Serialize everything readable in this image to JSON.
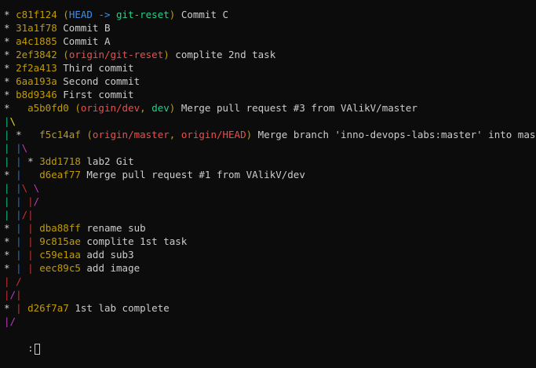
{
  "colors": {
    "default": "#cccccc",
    "hash": "#c19c00",
    "ref_paren": "#c19c00",
    "head": "#3b8eea",
    "local_branch": "#23d18b",
    "remote_branch": "#f14c4c",
    "graph_red": "#cd3131",
    "graph_green": "#0dbc79",
    "graph_yellow": "#e5e510",
    "graph_blue": "#2472c8",
    "graph_magenta": "#bc3fbc"
  },
  "lines": [
    {
      "segs": [
        [
          "* ",
          "default"
        ],
        [
          "c81f124",
          "hash"
        ],
        [
          " (",
          "ref_paren"
        ],
        [
          "HEAD -> ",
          "head"
        ],
        [
          "git-reset",
          "local_branch"
        ],
        [
          ")",
          "ref_paren"
        ],
        [
          " Commit C",
          "default"
        ]
      ]
    },
    {
      "segs": [
        [
          "* ",
          "default"
        ],
        [
          "31a1f78",
          "hash"
        ],
        [
          " Commit B",
          "default"
        ]
      ]
    },
    {
      "segs": [
        [
          "* ",
          "default"
        ],
        [
          "a4c1885",
          "hash"
        ],
        [
          " Commit A",
          "default"
        ]
      ]
    },
    {
      "segs": [
        [
          "* ",
          "default"
        ],
        [
          "2ef3842",
          "hash"
        ],
        [
          " (",
          "ref_paren"
        ],
        [
          "origin/git-reset",
          "remote_branch"
        ],
        [
          ")",
          "ref_paren"
        ],
        [
          " complite 2nd task",
          "default"
        ]
      ]
    },
    {
      "segs": [
        [
          "* ",
          "default"
        ],
        [
          "2f2a413",
          "hash"
        ],
        [
          " Third commit",
          "default"
        ]
      ]
    },
    {
      "segs": [
        [
          "* ",
          "default"
        ],
        [
          "6aa193a",
          "hash"
        ],
        [
          " Second commit",
          "default"
        ]
      ]
    },
    {
      "segs": [
        [
          "* ",
          "default"
        ],
        [
          "b8d9346",
          "hash"
        ],
        [
          " First commit",
          "default"
        ]
      ]
    },
    {
      "segs": [
        [
          "*   ",
          "default"
        ],
        [
          "a5b0fd0",
          "hash"
        ],
        [
          " (",
          "ref_paren"
        ],
        [
          "origin/dev",
          "remote_branch"
        ],
        [
          ", ",
          "ref_paren"
        ],
        [
          "dev",
          "local_branch"
        ],
        [
          ")",
          "ref_paren"
        ],
        [
          " Merge pull request #3 from VAlikV/master",
          "default"
        ]
      ]
    },
    {
      "segs": [
        [
          "|",
          "graph_green"
        ],
        [
          "\\",
          "graph_yellow"
        ]
      ]
    },
    {
      "segs": [
        [
          "| ",
          "graph_green"
        ],
        [
          "*   ",
          "default"
        ],
        [
          "f5c14af",
          "hash"
        ],
        [
          " (",
          "ref_paren"
        ],
        [
          "origin/master",
          "remote_branch"
        ],
        [
          ", ",
          "ref_paren"
        ],
        [
          "origin/HEAD",
          "remote_branch"
        ],
        [
          ")",
          "ref_paren"
        ],
        [
          " Merge branch 'inno-devops-labs:master' into master",
          "default"
        ]
      ]
    },
    {
      "segs": [
        [
          "| ",
          "graph_green"
        ],
        [
          "|",
          "graph_blue"
        ],
        [
          "\\",
          "graph_magenta"
        ]
      ]
    },
    {
      "segs": [
        [
          "| ",
          "graph_green"
        ],
        [
          "| ",
          "graph_blue"
        ],
        [
          "* ",
          "default"
        ],
        [
          "3dd1718",
          "hash"
        ],
        [
          " lab2 Git",
          "default"
        ]
      ]
    },
    {
      "segs": [
        [
          "* ",
          "default"
        ],
        [
          "| ",
          "graph_blue"
        ],
        [
          "  ",
          "default"
        ],
        [
          "d6eaf77",
          "hash"
        ],
        [
          " Merge pull request #1 from VAlikV/dev",
          "default"
        ]
      ]
    },
    {
      "segs": [
        [
          "| ",
          "graph_green"
        ],
        [
          "|",
          "graph_blue"
        ],
        [
          "\\ ",
          "graph_red"
        ],
        [
          "\\",
          "graph_magenta"
        ]
      ]
    },
    {
      "segs": [
        [
          "| ",
          "graph_green"
        ],
        [
          "| ",
          "graph_blue"
        ],
        [
          "|",
          "graph_red"
        ],
        [
          "/",
          "graph_magenta"
        ]
      ]
    },
    {
      "segs": [
        [
          "| ",
          "graph_green"
        ],
        [
          "|",
          "graph_blue"
        ],
        [
          "/",
          "graph_red"
        ],
        [
          "|",
          "graph_red"
        ]
      ]
    },
    {
      "segs": [
        [
          "* ",
          "default"
        ],
        [
          "| ",
          "graph_blue"
        ],
        [
          "| ",
          "graph_red"
        ],
        [
          "dba88ff",
          "hash"
        ],
        [
          " rename sub",
          "default"
        ]
      ]
    },
    {
      "segs": [
        [
          "* ",
          "default"
        ],
        [
          "| ",
          "graph_blue"
        ],
        [
          "| ",
          "graph_red"
        ],
        [
          "9c815ae",
          "hash"
        ],
        [
          " complite 1st task",
          "default"
        ]
      ]
    },
    {
      "segs": [
        [
          "* ",
          "default"
        ],
        [
          "| ",
          "graph_blue"
        ],
        [
          "| ",
          "graph_red"
        ],
        [
          "c59e1aa",
          "hash"
        ],
        [
          " add sub3",
          "default"
        ]
      ]
    },
    {
      "segs": [
        [
          "* ",
          "default"
        ],
        [
          "| ",
          "graph_blue"
        ],
        [
          "| ",
          "graph_red"
        ],
        [
          "eec89c5",
          "hash"
        ],
        [
          " add image",
          "default"
        ]
      ]
    },
    {
      "segs": [
        [
          "| ",
          "graph_red"
        ],
        [
          "/",
          "graph_red"
        ]
      ]
    },
    {
      "segs": [
        [
          "|",
          "graph_red"
        ],
        [
          "/",
          "graph_magenta"
        ],
        [
          "|",
          "graph_red"
        ]
      ]
    },
    {
      "segs": [
        [
          "* ",
          "default"
        ],
        [
          "| ",
          "graph_red"
        ],
        [
          "d26f7a7",
          "hash"
        ],
        [
          " 1st lab complete",
          "default"
        ]
      ]
    },
    {
      "segs": [
        [
          "|",
          "graph_magenta"
        ],
        [
          "/",
          "graph_magenta"
        ]
      ]
    }
  ],
  "prompt": ":"
}
